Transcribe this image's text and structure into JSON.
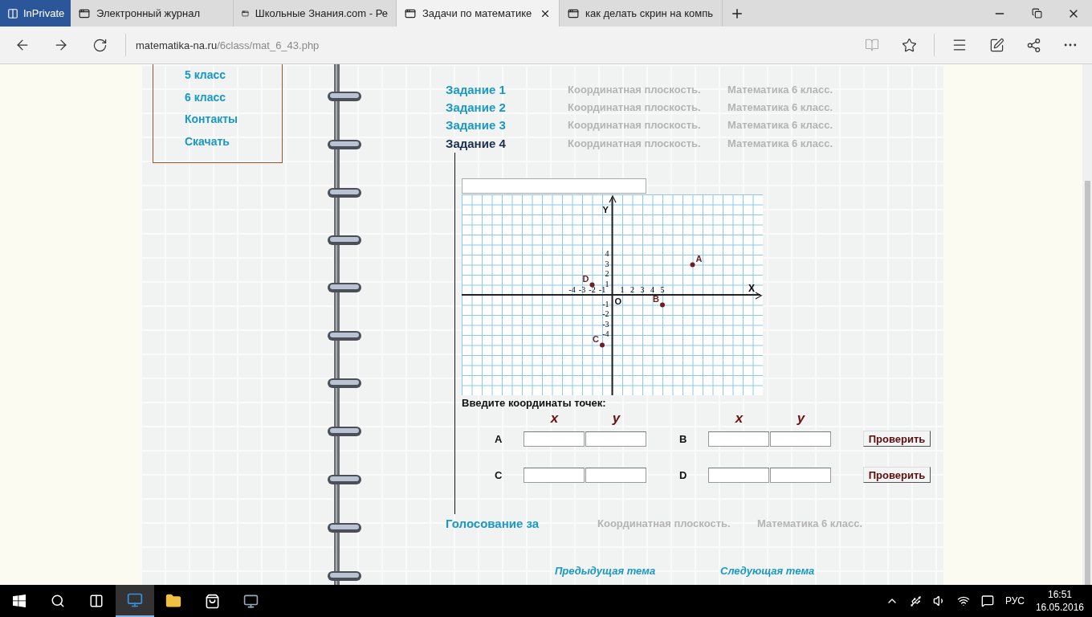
{
  "browser": {
    "private_badge": "InPrivate",
    "tabs": [
      {
        "label": "Электронный журнал",
        "selected": false
      },
      {
        "label": "Школьные Знания.com - Ре",
        "selected": false
      },
      {
        "label": "Задачи по математике",
        "selected": true
      },
      {
        "label": "как делать скрин на компь",
        "selected": false
      }
    ],
    "address": {
      "host": "matematika-na.ru",
      "path": "/6class/mat_6_43.php"
    }
  },
  "menu": [
    "5 класс",
    "6 класс",
    "Контакты",
    "Скачать"
  ],
  "tasks": [
    {
      "label": "Задание 1",
      "selected": false,
      "topic": "Координатная плоскость.",
      "subject": "Математика 6 класс."
    },
    {
      "label": "Задание 2",
      "selected": false,
      "topic": "Координатная плоскость.",
      "subject": "Математика 6 класс."
    },
    {
      "label": "Задание 3",
      "selected": false,
      "topic": "Координатная плоскость.",
      "subject": "Математика 6 класс."
    },
    {
      "label": "Задание 4",
      "selected": true,
      "topic": "Координатная плоскость.",
      "subject": "Математика 6 класс."
    }
  ],
  "exercise": {
    "chart_data": {
      "type": "scatter",
      "xlabel": "X",
      "ylabel": "Y",
      "xlim": [
        -15,
        15
      ],
      "ylim": [
        -10,
        10
      ],
      "xticks": [
        {
          "value": -4,
          "label": "-4"
        },
        {
          "value": -3,
          "label": "-3"
        },
        {
          "value": -2,
          "label": "-2"
        },
        {
          "value": -1,
          "label": "-1"
        },
        {
          "value": 1,
          "label": "1"
        },
        {
          "value": 2,
          "label": "2"
        },
        {
          "value": 3,
          "label": "3"
        },
        {
          "value": 4,
          "label": "4"
        },
        {
          "value": 5,
          "label": "5"
        }
      ],
      "yticks": [
        {
          "value": 4,
          "label": "4"
        },
        {
          "value": 3,
          "label": "3"
        },
        {
          "value": 2,
          "label": "2"
        },
        {
          "value": 1,
          "label": "1"
        },
        {
          "value": -1,
          "label": "-1"
        },
        {
          "value": -2,
          "label": "-2"
        },
        {
          "value": -3,
          "label": "-3"
        },
        {
          "value": -4,
          "label": "-4"
        }
      ],
      "grid": true,
      "series": [
        {
          "color": "#6b1f1f",
          "x": [
            8,
            5,
            -1,
            -2
          ],
          "values": [
            3,
            -1,
            -5,
            1
          ]
        }
      ],
      "annotations": [
        "O",
        {
          "x": 8,
          "y": 3,
          "text": "A"
        },
        {
          "x": 5,
          "y": -1,
          "text": "B"
        },
        {
          "x": -1,
          "y": -5,
          "text": "C"
        },
        {
          "x": -2,
          "y": 1,
          "text": "D"
        }
      ]
    },
    "prompt": "Введите координаты точек:",
    "headers": [
      "x",
      "y",
      "x",
      "y"
    ],
    "rows": [
      {
        "points": [
          "A",
          "B"
        ],
        "button": "Проверить"
      },
      {
        "points": [
          "C",
          "D"
        ],
        "button": "Проверить"
      }
    ]
  },
  "vote": {
    "label": "Голосование за",
    "topic": "Координатная плоскость.",
    "subject": "Математика 6 класс."
  },
  "nav": [
    "Предыдущая тема",
    "Следующая тема"
  ],
  "taskbar": {
    "language": "РУС",
    "time": "16:51",
    "date": "16.05.2016"
  }
}
